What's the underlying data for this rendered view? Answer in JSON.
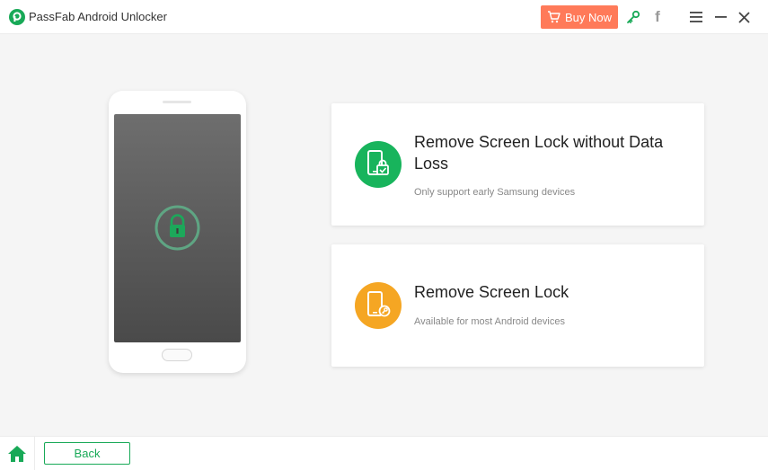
{
  "titlebar": {
    "app_title": "PassFab Android Unlocker",
    "buy_label": "Buy Now",
    "icons": [
      "cart-icon",
      "key-icon",
      "facebook-icon",
      "menu-icon",
      "minimize-icon",
      "close-icon"
    ],
    "facebook_glyph": "f"
  },
  "phone": {
    "icon": "lock-icon"
  },
  "options": [
    {
      "title": "Remove Screen Lock without Data Loss",
      "description": "Only support early Samsung devices",
      "icon": "phone-lock-icon",
      "color": "#18b45c"
    },
    {
      "title": "Remove Screen Lock",
      "description": "Available for most Android devices",
      "icon": "phone-key-icon",
      "color": "#f5a623"
    }
  ],
  "footer": {
    "back_label": "Back",
    "home_icon": "home-icon"
  },
  "colors": {
    "brand_green": "#18a957",
    "buy_orange": "#ff7a59"
  }
}
